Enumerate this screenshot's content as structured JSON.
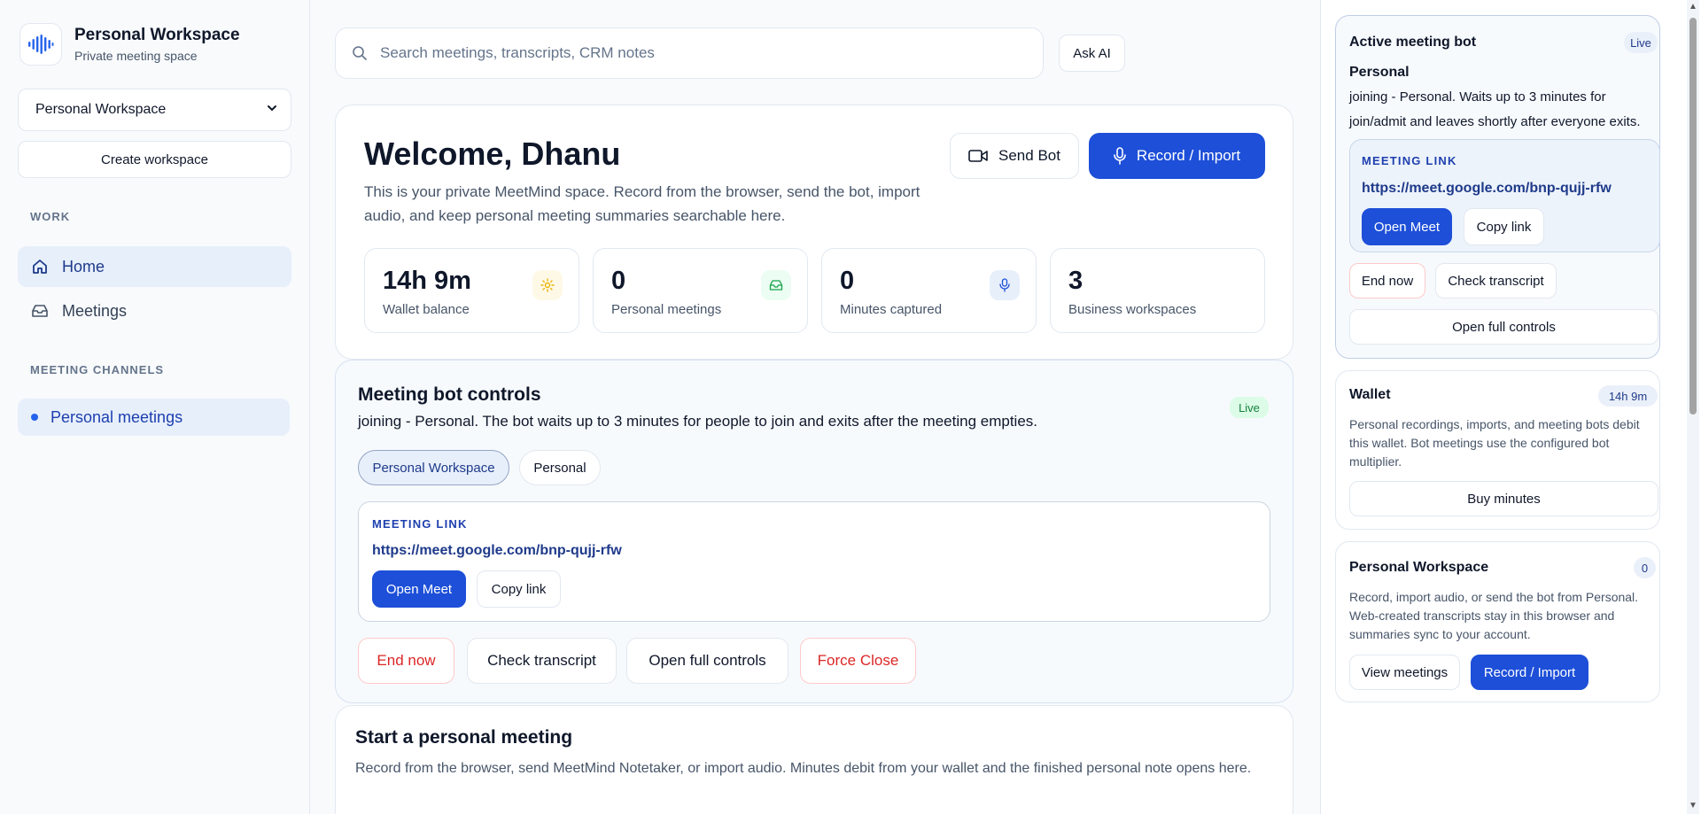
{
  "sidebar": {
    "brand_title": "Personal Workspace",
    "brand_sub": "Private meeting space",
    "workspace_select": "Personal Workspace",
    "create_workspace": "Create workspace",
    "work_label": "WORK",
    "nav": [
      {
        "label": "Home",
        "icon": "home-icon",
        "active": true
      },
      {
        "label": "Meetings",
        "icon": "inbox-icon",
        "active": false
      }
    ],
    "channels_label": "MEETING CHANNELS",
    "channel": "Personal meetings"
  },
  "search": {
    "placeholder": "Search meetings, transcripts, CRM notes",
    "ask_ai": "Ask AI"
  },
  "welcome": {
    "title": "Welcome, Dhanu",
    "desc": "This is your private MeetMind space. Record from the browser, send the bot, import audio, and keep personal meeting summaries searchable here.",
    "send_bot": "Send Bot",
    "record_import": "Record / Import",
    "stats": [
      {
        "value": "14h 9m",
        "label": "Wallet balance",
        "icon": "sun-icon"
      },
      {
        "value": "0",
        "label": "Personal meetings",
        "icon": "inbox-icon"
      },
      {
        "value": "0",
        "label": "Minutes captured",
        "icon": "mic-icon"
      },
      {
        "value": "3",
        "label": "Business workspaces",
        "icon": ""
      }
    ]
  },
  "bot_controls": {
    "title": "Meeting bot controls",
    "desc": "joining - Personal. The bot waits up to 3 minutes for people to join and exits after the meeting empties.",
    "live": "Live",
    "pills": [
      "Personal Workspace",
      "Personal"
    ],
    "meeting_link_label": "MEETING LINK",
    "meeting_link": "https://meet.google.com/bnp-qujj-rfw",
    "open_meet": "Open Meet",
    "copy_link": "Copy link",
    "end_now": "End now",
    "check_transcript": "Check transcript",
    "open_full_controls": "Open full controls",
    "force_close": "Force Close"
  },
  "start_meeting": {
    "title": "Start a personal meeting",
    "desc": "Record from the browser, send MeetMind Notetaker, or import audio. Minutes debit from your wallet and the finished personal note opens here."
  },
  "right": {
    "active_bot": {
      "title": "Active meeting bot",
      "live": "Live",
      "name": "Personal",
      "desc": "joining - Personal. Waits up to 3 minutes for join/admit and leaves shortly after everyone exits.",
      "meeting_link_label": "MEETING LINK",
      "meeting_link": "https://meet.google.com/bnp-qujj-rfw",
      "open_meet": "Open Meet",
      "copy_link": "Copy link",
      "end_now": "End now",
      "check_transcript": "Check transcript",
      "open_full_controls": "Open full controls"
    },
    "wallet": {
      "title": "Wallet",
      "badge": "14h 9m",
      "desc": "Personal recordings, imports, and meeting bots debit this wallet. Bot meetings use the configured bot multiplier.",
      "buy": "Buy minutes"
    },
    "workspace": {
      "title": "Personal Workspace",
      "badge": "0",
      "desc": "Record, import audio, or send the bot from Personal. Web-created transcripts stay in this browser and summaries sync to your account.",
      "view_meetings": "View meetings",
      "record_import": "Record / Import"
    }
  },
  "colors": {
    "primary": "#1d4fd8",
    "danger": "#dc2626",
    "live": "#15803d"
  }
}
